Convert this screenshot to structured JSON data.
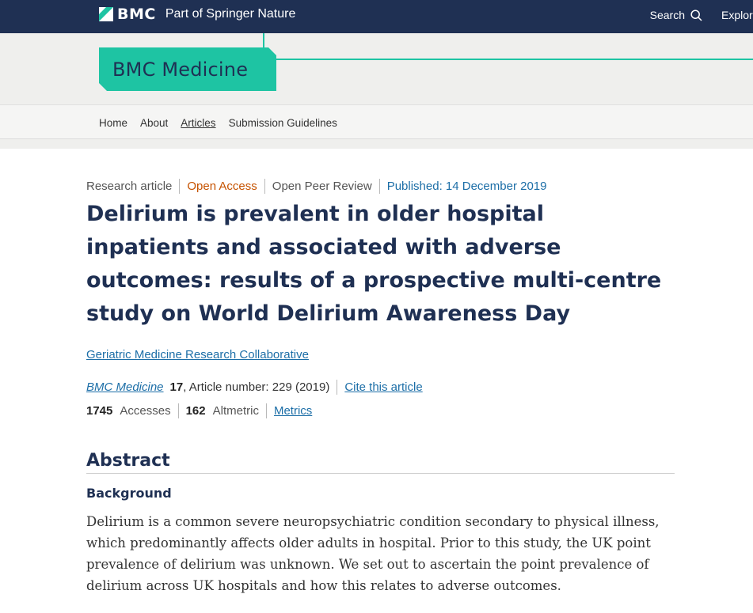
{
  "topbar": {
    "brand_name": "BMC",
    "brand_tagline": "Part of Springer Nature",
    "search_label": "Search",
    "explore_label": "Explore journals"
  },
  "journal": {
    "title": "BMC Medicine"
  },
  "nav": {
    "items": [
      {
        "label": "Home"
      },
      {
        "label": "About"
      },
      {
        "label": "Articles"
      },
      {
        "label": "Submission Guidelines"
      }
    ]
  },
  "article": {
    "type": "Research article",
    "access": "Open Access",
    "review": "Open Peer Review",
    "published": "Published: 14 December 2019",
    "title": "Delirium is prevalent in older hospital inpatients and associated with adverse outcomes: results of a prospective multi-centre study on World Delirium Awareness Day",
    "author": "Geriatric Medicine Research Collaborative",
    "journal_name": "BMC Medicine",
    "volume": "17",
    "article_number": ", Article number: 229 (2019)",
    "cite_label": "Cite this article",
    "accesses_count": "1745",
    "accesses_label": "Accesses",
    "altmetric_count": "162",
    "altmetric_label": "Altmetric",
    "metrics_label": "Metrics"
  },
  "abstract": {
    "heading": "Abstract",
    "background_heading": "Background",
    "background_text": "Delirium is a common severe neuropsychiatric condition secondary to physical illness, which predominantly affects older adults in hospital. Prior to this study, the UK point prevalence of delirium was unknown. We set out to ascertain the point prevalence of delirium across UK hospitals and how this relates to adverse outcomes."
  },
  "colors": {
    "topbar": "#1f3053",
    "accent": "#1ec4a3",
    "open_access": "#c65301",
    "link": "#1c6ea7",
    "title": "#1f3053"
  },
  "icons": {
    "brand": "bmc-logo-icon",
    "search": "search-icon"
  }
}
